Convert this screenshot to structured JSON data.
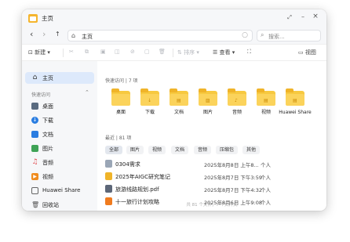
{
  "window": {
    "title": "主页"
  },
  "title_controls": {
    "restore": "⤢",
    "minimize": "–",
    "close": "×"
  },
  "nav": {
    "back": "‹",
    "forward": "›",
    "up": "↑",
    "address": "主页",
    "search_placeholder": "搜索..."
  },
  "toolbar": {
    "new_label": "新建",
    "sort_label": "排序",
    "view_label": "查看",
    "layout_label": "视图"
  },
  "sidebar": {
    "items": [
      {
        "label": "主页",
        "icon": "home-icon"
      },
      {
        "label": "桌面",
        "icon": "desktop-icon",
        "color": "#5a6b80"
      },
      {
        "label": "下载",
        "icon": "download-icon",
        "color": "#2a7de1"
      },
      {
        "label": "文档",
        "icon": "document-icon",
        "color": "#2a7de1"
      },
      {
        "label": "图片",
        "icon": "picture-icon",
        "color": "#3fa356"
      },
      {
        "label": "音频",
        "icon": "music-icon",
        "color": "#e0474c"
      },
      {
        "label": "视频",
        "icon": "video-icon",
        "color": "#f08c1e"
      },
      {
        "label": "Huawei Share",
        "icon": "folder-outline-icon"
      },
      {
        "label": "回收站",
        "icon": "trash-icon"
      }
    ],
    "quick_access_label": "快速访问"
  },
  "quick": {
    "title": "快速访问 | 7 项",
    "folders": [
      {
        "name": "桌面",
        "icon": "desktop-folder-icon"
      },
      {
        "name": "下载",
        "icon": "download-folder-icon"
      },
      {
        "name": "文档",
        "icon": "document-folder-icon"
      },
      {
        "name": "图片",
        "icon": "picture-folder-icon"
      },
      {
        "name": "音频",
        "icon": "music-folder-icon"
      },
      {
        "name": "视频",
        "icon": "video-folder-icon"
      },
      {
        "name": "Huawei Share",
        "icon": "share-folder-icon"
      }
    ]
  },
  "recent": {
    "title": "最近 | 81 项",
    "filters": [
      "全部",
      "图片",
      "视频",
      "文档",
      "音频",
      "压缩包",
      "其他"
    ],
    "rows": [
      {
        "name": "0304需求",
        "date": "2025年8月8日 上午8...",
        "owner": "个人",
        "icon": "folder-icon",
        "color": "#9aa6b6"
      },
      {
        "name": "2025年AIGC研究笔记",
        "date": "2025年8月7日 下午3:59",
        "owner": "个人",
        "icon": "note-file-icon",
        "color": "#f0b429"
      },
      {
        "name": "旅游线路规划.pdf",
        "date": "2025年8月7日 下午4:32",
        "owner": "个人",
        "icon": "pdf-file-icon",
        "color": "#5d6778"
      },
      {
        "name": "十一旅行计划攻略",
        "date": "2025年8月6日 上午9:08",
        "owner": "个人",
        "icon": "slides-file-icon",
        "color": "#f07b1e"
      }
    ]
  },
  "status": {
    "text": "共 81 个文件，7 个文件夹"
  }
}
